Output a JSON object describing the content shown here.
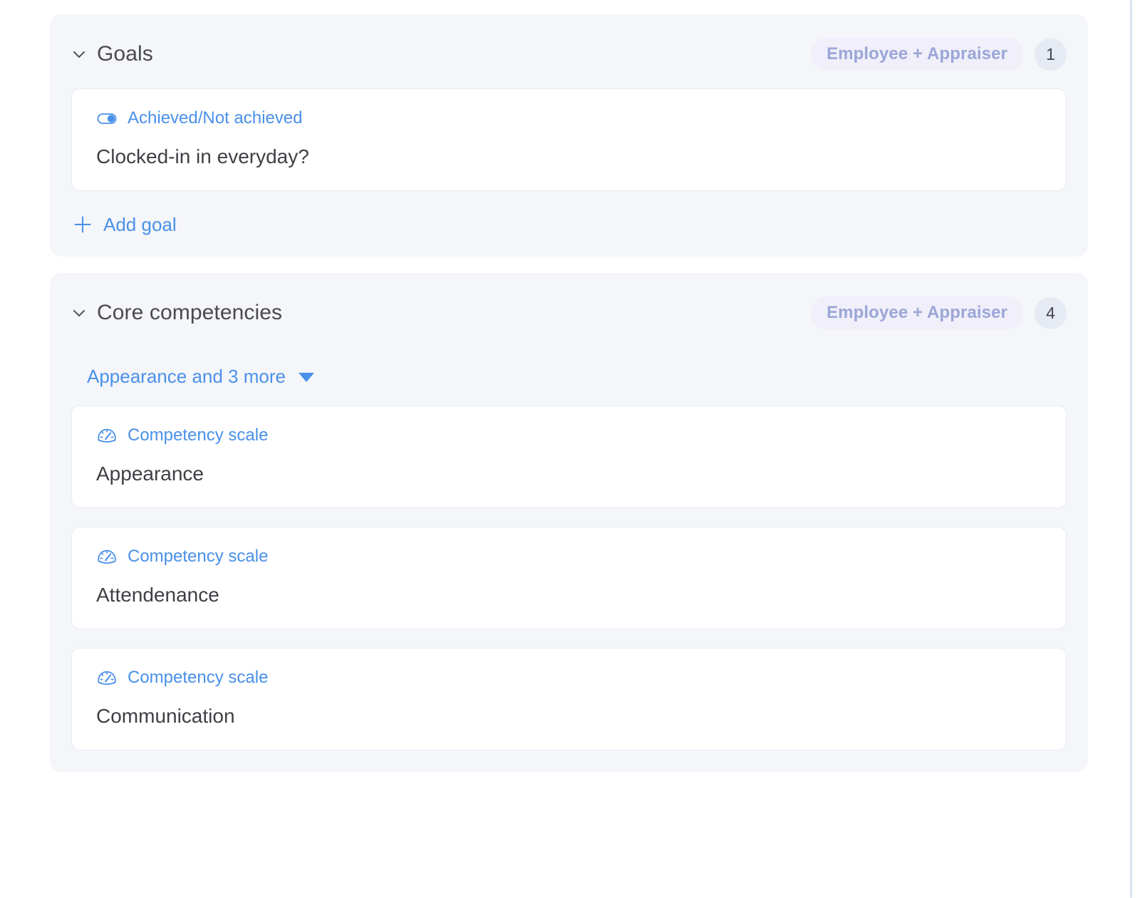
{
  "colors": {
    "accent_blue": "#4a90e8",
    "panel_bg": "#f4f6fa",
    "pill_bg": "#f0effa",
    "pill_text": "#9ba6d8",
    "count_bg": "#e6eaf3",
    "card_border": "#e8ebf2",
    "text_dark": "#3f4045"
  },
  "sections": [
    {
      "id": "goals",
      "title": "Goals",
      "chevron_icon": "chevron-down-icon",
      "audience": "Employee + Appraiser",
      "count": "1",
      "items": [
        {
          "type_label": "Achieved/Not achieved",
          "type_icon": "toggle-icon",
          "title": "Clocked-in in everyday?"
        }
      ],
      "add_action": {
        "label": "Add goal",
        "icon": "plus-icon"
      }
    },
    {
      "id": "core-competencies",
      "title": "Core competencies",
      "chevron_icon": "chevron-down-icon",
      "audience": "Employee + Appraiser",
      "count": "4",
      "filter": {
        "label": "Appearance and 3 more",
        "icon": "caret-down-icon"
      },
      "items": [
        {
          "type_label": "Competency scale",
          "type_icon": "gauge-icon",
          "title": "Appearance"
        },
        {
          "type_label": "Competency scale",
          "type_icon": "gauge-icon",
          "title": "Attendenance"
        },
        {
          "type_label": "Competency scale",
          "type_icon": "gauge-icon",
          "title": "Communication"
        }
      ]
    }
  ]
}
